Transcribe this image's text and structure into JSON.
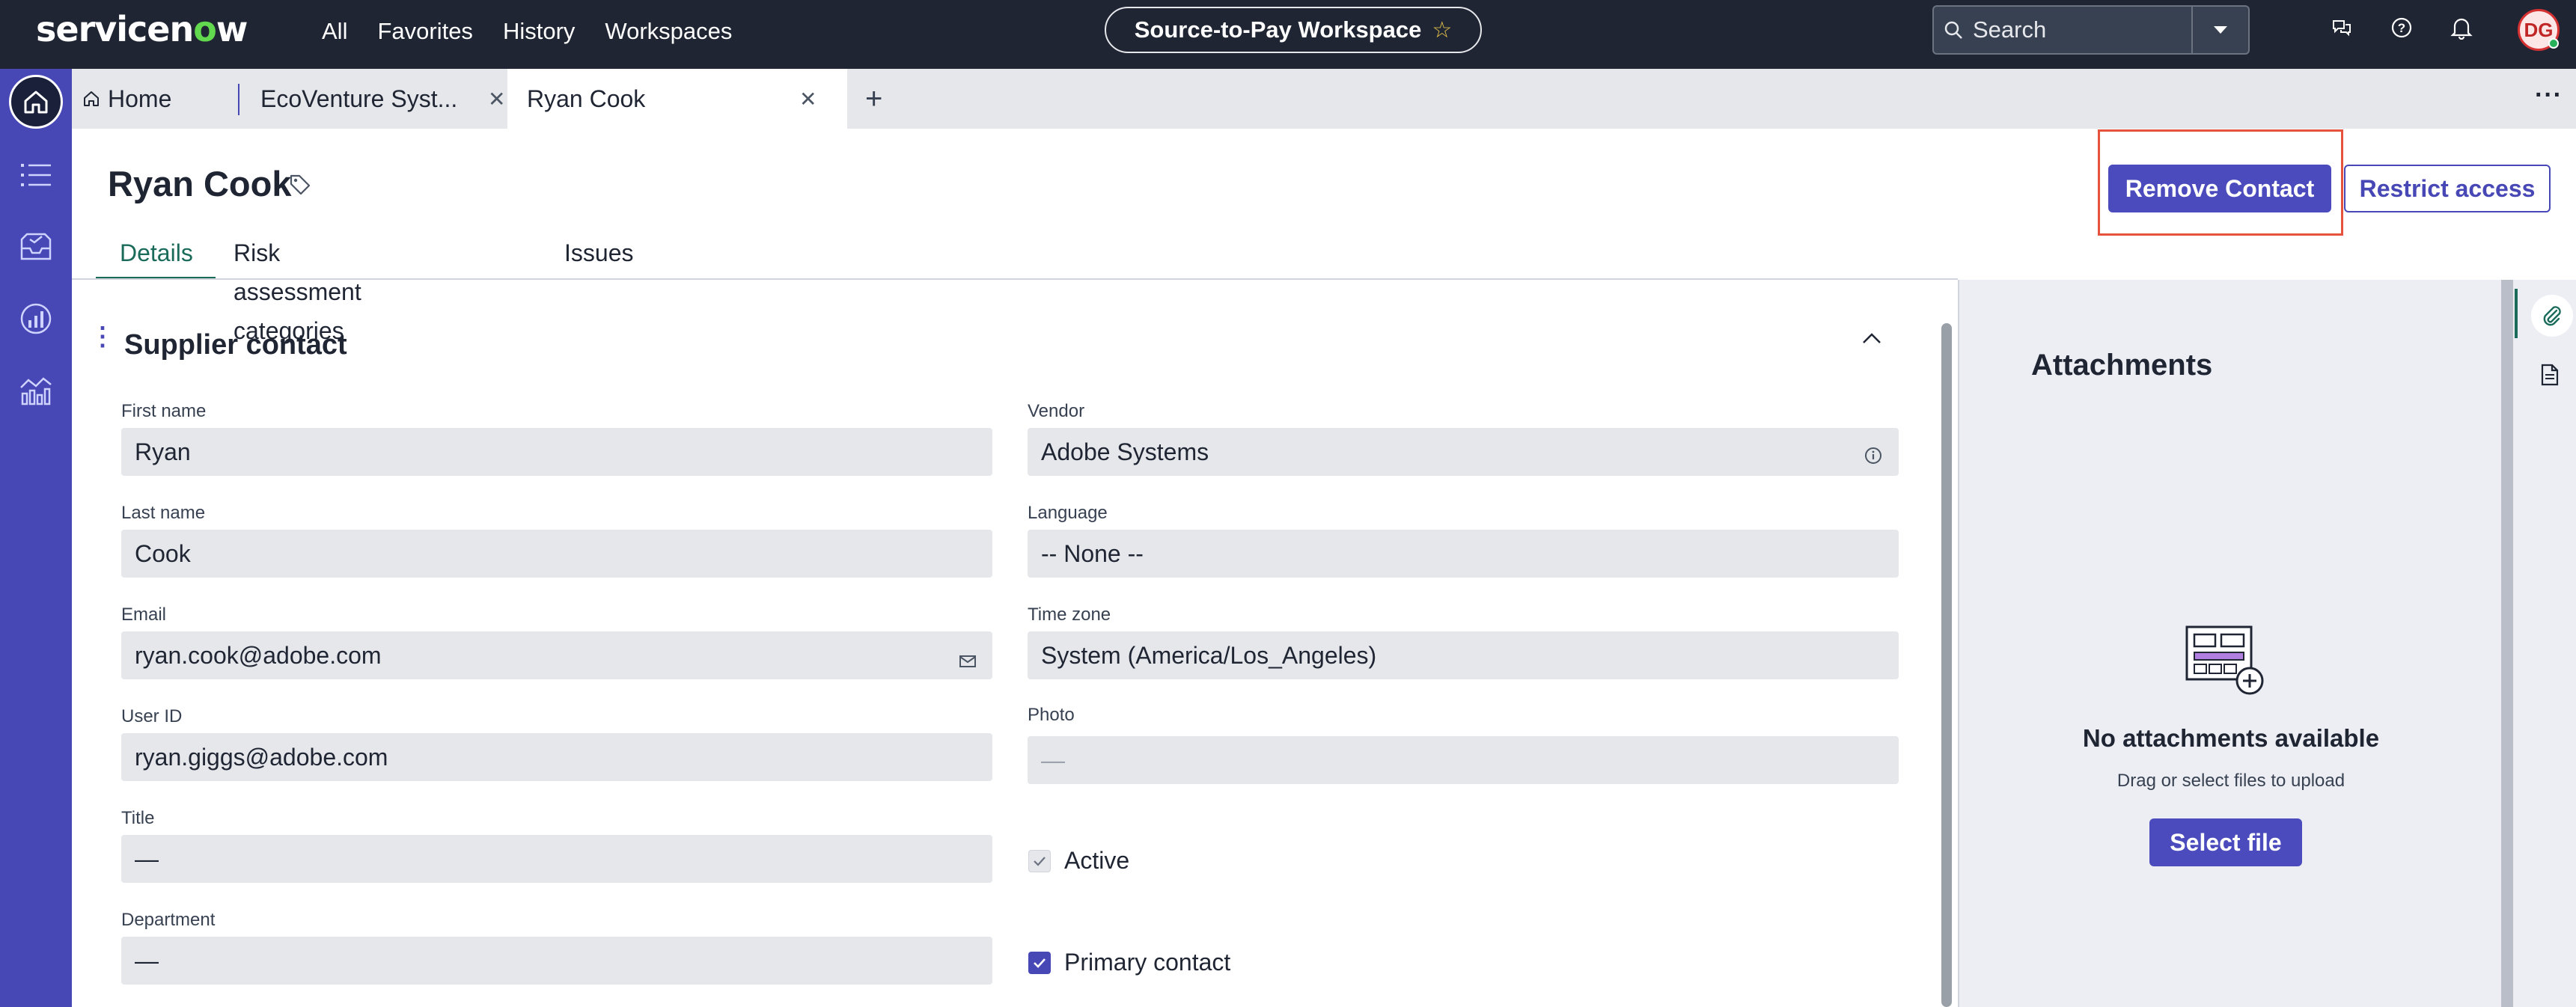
{
  "app": {
    "logo_text_a": "servicen",
    "logo_text_o": "o",
    "logo_text_b": "w",
    "nav": [
      "All",
      "Favorites",
      "History",
      "Workspaces"
    ],
    "workspace": "Source-to-Pay Workspace",
    "search_placeholder": "Search",
    "user_initials": "DG"
  },
  "tabs": [
    {
      "label": "Home"
    },
    {
      "label": "EcoVenture Syst..."
    },
    {
      "label": "Ryan Cook"
    }
  ],
  "record": {
    "title": "Ryan Cook",
    "remove_button": "Remove Contact",
    "restrict_button": "Restrict access",
    "subtabs": [
      "Details",
      "Risk assessment categories",
      "Issues"
    ]
  },
  "form": {
    "section_title": "Supplier contact",
    "first_name": {
      "label": "First name",
      "value": "Ryan"
    },
    "last_name": {
      "label": "Last name",
      "value": "Cook"
    },
    "email": {
      "label": "Email",
      "value": "ryan.cook@adobe.com"
    },
    "user_id": {
      "label": "User ID",
      "value": "ryan.giggs@adobe.com"
    },
    "title": {
      "label": "Title",
      "value": "—"
    },
    "department": {
      "label": "Department",
      "value": "—"
    },
    "vendor": {
      "label": "Vendor",
      "value": "Adobe Systems"
    },
    "language": {
      "label": "Language",
      "value": "-- None --"
    },
    "time_zone": {
      "label": "Time zone",
      "value": "System (America/Los_Angeles)"
    },
    "photo": {
      "label": "Photo",
      "value": "—"
    },
    "active": {
      "label": "Active",
      "checked": true
    },
    "primary_contact": {
      "label": "Primary contact",
      "checked": true
    }
  },
  "attachments": {
    "title": "Attachments",
    "empty_title": "No attachments available",
    "empty_hint": "Drag or select files to upload",
    "select_button": "Select file"
  },
  "colors": {
    "nav_bg": "#1f2533",
    "rail_bg": "#4747b6",
    "primary": "#4b4bbe",
    "active_tab": "#1a6b5a",
    "highlight": "#e5533d"
  }
}
